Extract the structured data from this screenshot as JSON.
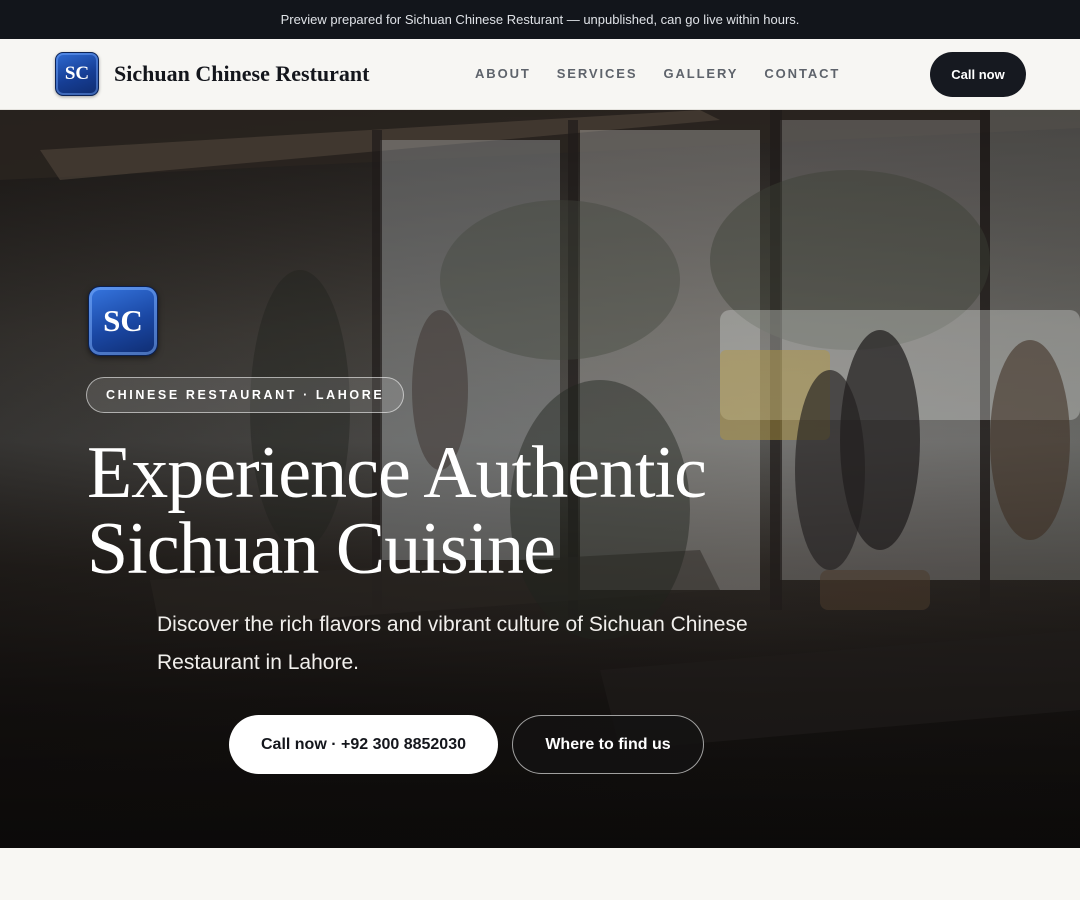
{
  "preview_bar": {
    "text": "Preview prepared for Sichuan Chinese Resturant — unpublished, can go live within hours."
  },
  "header": {
    "logo_text": "SC",
    "brand_name": "Sichuan Chinese Resturant",
    "nav": [
      "ABOUT",
      "SERVICES",
      "GALLERY",
      "CONTACT"
    ],
    "cta_label": "Call now"
  },
  "hero": {
    "logo_text": "SC",
    "pill": "CHINESE RESTAURANT · LAHORE",
    "title_line1": "Experience Authentic",
    "title_line2": "Sichuan Cuisine",
    "subtitle": "Discover the rich flavors and vibrant culture of Sichuan Chinese Restaurant in Lahore.",
    "primary_button": "Call now · +92 300 8852030",
    "secondary_button": "Where to find us"
  },
  "colors": {
    "brand_blue": "#1a47a3",
    "dark": "#161920",
    "page_background": "#f8f7f3"
  }
}
